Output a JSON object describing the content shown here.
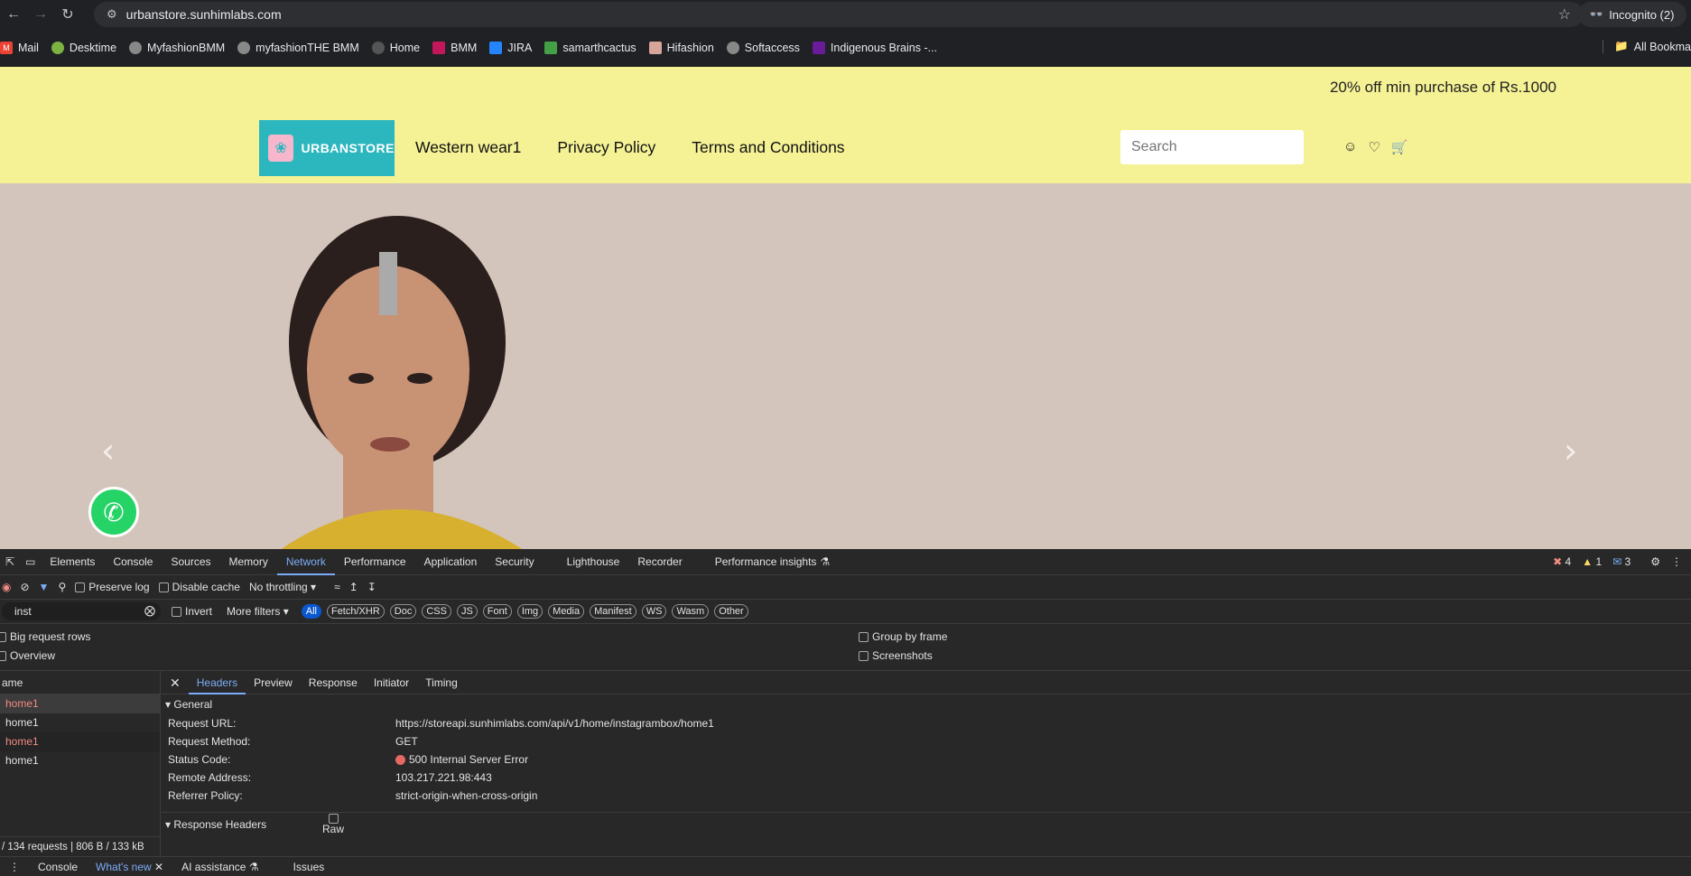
{
  "browser": {
    "url": "urbanstore.sunhimlabs.com",
    "incognito_label": "Incognito (2)",
    "bookmarks": [
      "Mail",
      "Desktime",
      "MyfashionBMM",
      "myfashionTHE BMM",
      "Home",
      "BMM",
      "JIRA",
      "samarthcactus",
      "Hifashion",
      "Softaccess",
      "Indigenous Brains -..."
    ],
    "all_bookmarks": "All Bookma"
  },
  "site": {
    "promo": "20% off min purchase of Rs.1000",
    "logo_text": "URBANSTORE",
    "nav": [
      "Western wear1",
      "Privacy Policy",
      "Terms and Conditions"
    ],
    "search_placeholder": "Search"
  },
  "devtools": {
    "tabs": [
      "Elements",
      "Console",
      "Sources",
      "Memory",
      "Network",
      "Performance",
      "Application",
      "Security",
      "Lighthouse",
      "Recorder",
      "Performance insights"
    ],
    "active_tab": "Network",
    "counts": {
      "errors": "4",
      "warnings": "1",
      "messages": "3"
    },
    "toolbar": {
      "preserve_log": "Preserve log",
      "disable_cache": "Disable cache",
      "throttling": "No throttling"
    },
    "filter": {
      "value": "inst",
      "invert": "Invert",
      "more_filters": "More filters",
      "chips": [
        "All",
        "Fetch/XHR",
        "Doc",
        "CSS",
        "JS",
        "Font",
        "Img",
        "Media",
        "Manifest",
        "WS",
        "Wasm",
        "Other"
      ]
    },
    "options": {
      "big_rows": "Big request rows",
      "overview": "Overview",
      "group_by_frame": "Group by frame",
      "screenshots": "Screenshots"
    },
    "name_header": "ame",
    "requests": [
      "home1",
      "home1",
      "home1",
      "home1"
    ],
    "summary": "/ 134 requests | 806 B / 133 kB",
    "detail_tabs": [
      "Headers",
      "Preview",
      "Response",
      "Initiator",
      "Timing"
    ],
    "general_label": "General",
    "general": [
      {
        "k": "Request URL:",
        "v": "https://storeapi.sunhimlabs.com/api/v1/home/instagrambox/home1"
      },
      {
        "k": "Request Method:",
        "v": "GET"
      },
      {
        "k": "Status Code:",
        "v": "500 Internal Server Error"
      },
      {
        "k": "Remote Address:",
        "v": "103.217.221.98:443"
      },
      {
        "k": "Referrer Policy:",
        "v": "strict-origin-when-cross-origin"
      }
    ],
    "response_headers_label": "Response Headers",
    "raw_label": "Raw",
    "drawer_tabs": [
      "Console",
      "What's new",
      "AI assistance",
      "Issues"
    ]
  }
}
